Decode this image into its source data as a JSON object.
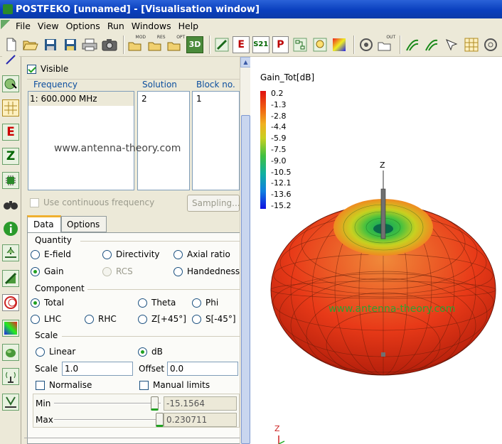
{
  "window": {
    "title": "POSTFEKO [unnamed] - [Visualisation window]"
  },
  "menu": [
    "File",
    "View",
    "Options",
    "Run",
    "Windows",
    "Help"
  ],
  "toolbar": {
    "new_label": "",
    "badges": {
      "mod": "MOD",
      "res": "RES",
      "opt": "OPT",
      "out": "OUT"
    },
    "three_d": "3D",
    "e_icon": "E",
    "s21_icon": "S21",
    "p_icon": "P"
  },
  "left_tools": {
    "e_icon": "E",
    "z_icon": "Z"
  },
  "panel": {
    "visible_label": "Visible",
    "visible_checked": true,
    "columns": {
      "frequency": "Frequency",
      "solution": "Solution",
      "block": "Block no."
    },
    "frequency_value": "1: 600.000 MHz",
    "solution_value": "2",
    "block_value": "1",
    "watermark": "www.antenna-theory.com",
    "continuous_freq_label": "Use continuous frequency",
    "sampling_button": "Sampling...",
    "tabs": [
      "Data",
      "Options"
    ],
    "quantity": {
      "title": "Quantity",
      "efield": "E-field",
      "directivity": "Directivity",
      "axial_ratio": "Axial ratio",
      "gain": "Gain",
      "rcs": "RCS",
      "handedness": "Handedness"
    },
    "component": {
      "title": "Component",
      "total": "Total",
      "theta": "Theta",
      "phi": "Phi",
      "lhc": "LHC",
      "rhc": "RHC",
      "z45p": "Z[+45°]",
      "s45m": "S[-45°]"
    },
    "scale": {
      "title": "Scale",
      "linear": "Linear",
      "db": "dB",
      "scale_label": "Scale",
      "scale_value": "1.0",
      "offset_label": "Offset",
      "offset_value": "0.0",
      "normalise": "Normalise",
      "manual_limits": "Manual limits",
      "min_label": "Min",
      "min_value": "-15.1564",
      "max_label": "Max",
      "max_value": "0.230711"
    }
  },
  "visualisation": {
    "legend_title": "Gain_Tot[dB]",
    "legend_values": [
      "0.2",
      "-1.3",
      "-2.8",
      "-4.4",
      "-5.9",
      "-7.5",
      "-9.0",
      "-10.5",
      "-12.1",
      "-13.6",
      "-15.2"
    ],
    "z_axis": "Z",
    "watermark": "www.antenna-theory.com",
    "corner_z": "Z"
  }
}
